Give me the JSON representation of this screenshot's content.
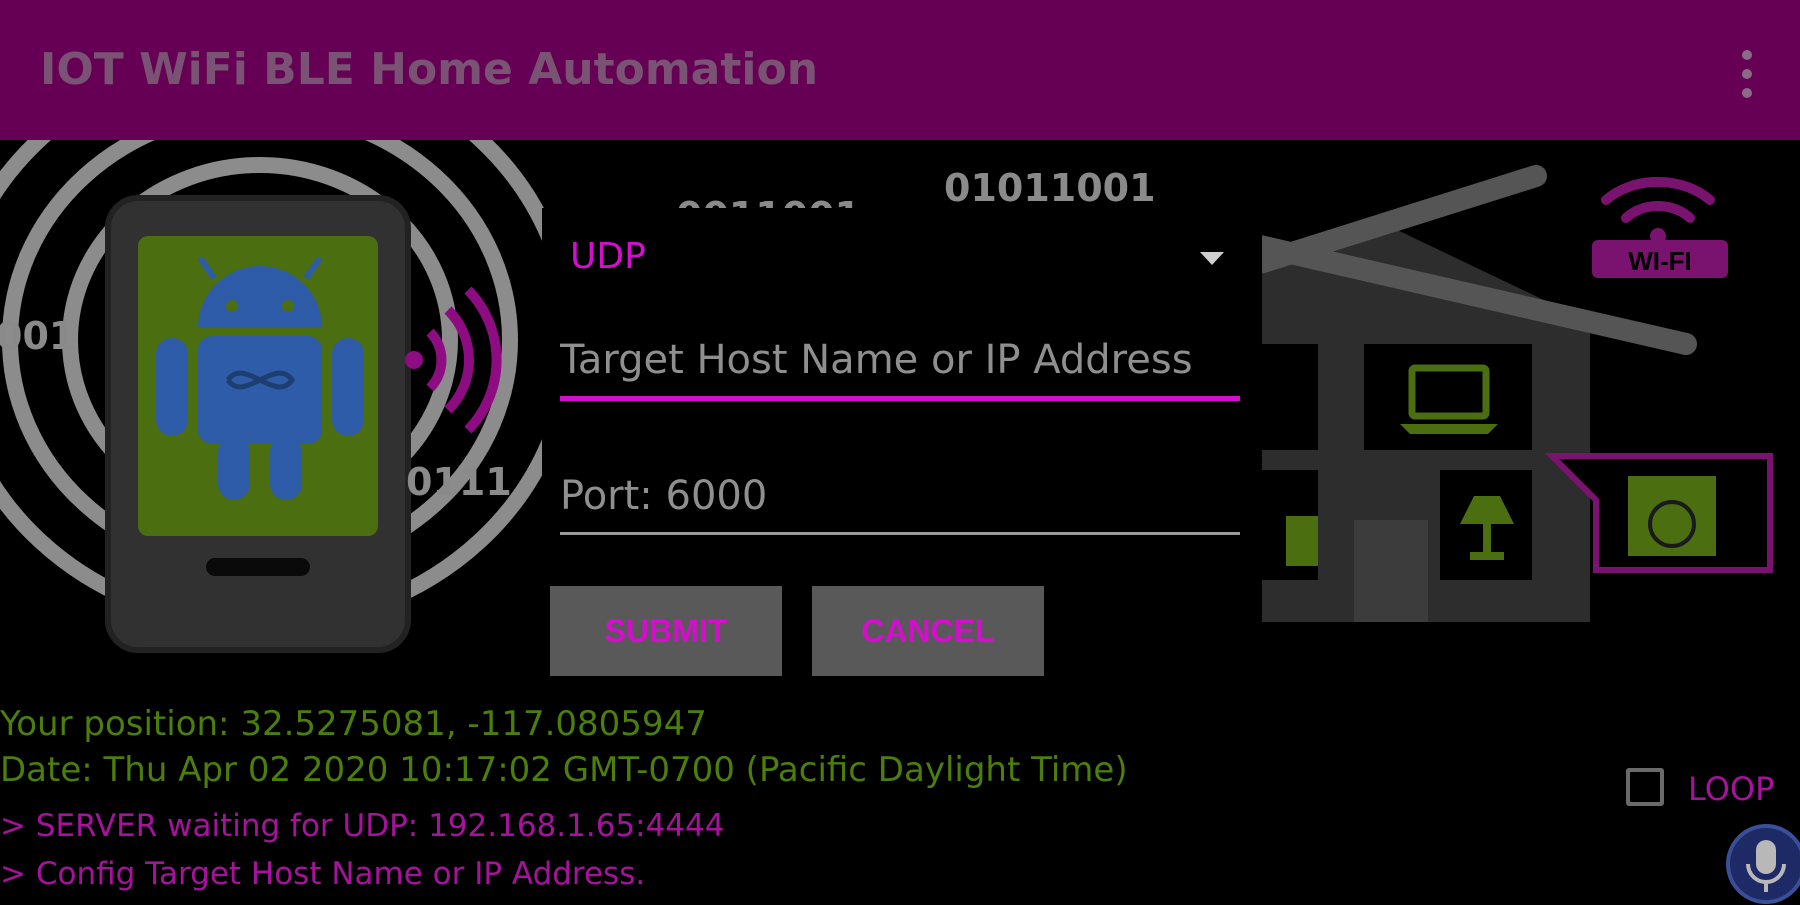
{
  "app": {
    "title": "IOT WiFi BLE Home Automation"
  },
  "toolbar": {
    "overflow_icon": "more-vert-icon"
  },
  "illustration": {
    "binary_texts": [
      "01011001",
      "0011001",
      "001",
      "0111"
    ],
    "wifi_badge": "WI-FI"
  },
  "dialog": {
    "protocol": "UDP",
    "protocol_icon": "dropdown-arrow-icon",
    "host_placeholder": "Target Host Name or IP Address",
    "host_value": "",
    "port_value": "Port: 6000",
    "submit_label": "SUBMIT",
    "cancel_label": "CANCEL"
  },
  "status": {
    "position": "Your position: 32.5275081, -117.0805947",
    "date": "Date: Thu Apr 02 2020 10:17:02 GMT-0700 (Pacific Daylight Time)"
  },
  "log": {
    "lines": [
      "> SERVER waiting for UDP: 192.168.1.65:4444",
      "> Config Target Host Name or IP Address."
    ]
  },
  "loop": {
    "label": "LOOP",
    "checked": false
  },
  "mic": {
    "icon": "microphone-icon"
  },
  "colors": {
    "appbar": "#660055",
    "accent": "#d40ecd",
    "info_text": "#4b7e0b",
    "log_text": "#a6129b",
    "button_bg": "#595959"
  }
}
